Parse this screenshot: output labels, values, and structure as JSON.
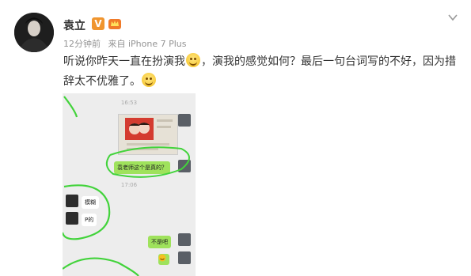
{
  "post": {
    "username": "袁立",
    "verified_badge": "V",
    "time_ago": "12分钟前",
    "source": "来自 iPhone 7 Plus",
    "text_part1": "听说你昨天一直在扮演我",
    "text_part2": "，演我的感觉如何？最后一句台词写的不好，因为措辞太不优雅了。",
    "icons": {
      "more": "chevron-down-icon",
      "crown": "crown-icon",
      "emoji": "grin-emoji-icon"
    }
  },
  "chat": {
    "timestamp_top": "16:53",
    "timestamp_mid": "17:06",
    "msg_question": "袁老师这个是真的？",
    "msg_reply1": "模糊",
    "msg_reply2": "P的",
    "msg_sent": "不是吧",
    "accent_green": "#9fe25c",
    "highlight_green": "#42d33b"
  }
}
